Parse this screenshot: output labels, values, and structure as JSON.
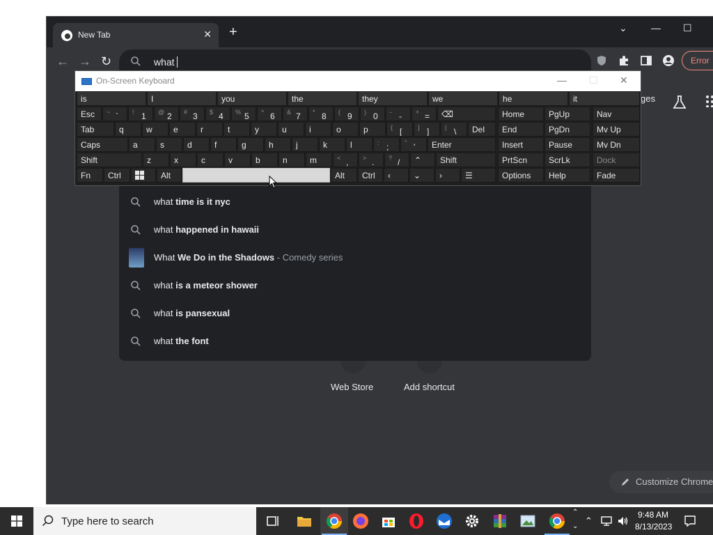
{
  "browser": {
    "tab_title": "New Tab",
    "omnibox_text": "what",
    "error_label": "Error",
    "partial_header_text": "ges"
  },
  "suggestions": [
    {
      "prefix": "what",
      "bold": "time is it nyc",
      "sub": ""
    },
    {
      "prefix": "what",
      "bold": "happened in hawaii",
      "sub": ""
    },
    {
      "prefix": "What",
      "bold": "We Do in the Shadows",
      "sub": " - Comedy series"
    },
    {
      "prefix": "what",
      "bold": "is a meteor shower",
      "sub": ""
    },
    {
      "prefix": "what",
      "bold": "is pansexual",
      "sub": ""
    },
    {
      "prefix": "what",
      "bold": "the font",
      "sub": ""
    }
  ],
  "ntp": {
    "shortcut_webstore": "Web Store",
    "shortcut_add": "Add shortcut",
    "customize": "Customize Chrome"
  },
  "osk": {
    "title": "On-Screen Keyboard",
    "predictions": [
      "is",
      "I",
      "you",
      "the",
      "they",
      "we",
      "he",
      "it"
    ],
    "row1": [
      "Esc"
    ],
    "row1_keys": [
      {
        "s": "~",
        "m": "`"
      },
      {
        "s": "!",
        "m": "1"
      },
      {
        "s": "@",
        "m": "2"
      },
      {
        "s": "#",
        "m": "3"
      },
      {
        "s": "$",
        "m": "4"
      },
      {
        "s": "%",
        "m": "5"
      },
      {
        "s": "^",
        "m": "6"
      },
      {
        "s": "&",
        "m": "7"
      },
      {
        "s": "*",
        "m": "8"
      },
      {
        "s": "(",
        "m": "9"
      },
      {
        "s": ")",
        "m": "0"
      },
      {
        "s": "-",
        "m": "-"
      },
      {
        "s": "+",
        "m": "="
      }
    ],
    "row2": [
      "Tab",
      "q",
      "w",
      "e",
      "r",
      "t",
      "y",
      "u",
      "i",
      "o",
      "p"
    ],
    "row2_sym": [
      {
        "s": "{",
        "m": "["
      },
      {
        "s": "}",
        "m": "]"
      },
      {
        "s": "|",
        "m": "\\"
      }
    ],
    "del": "Del",
    "row3": [
      "Caps",
      "a",
      "s",
      "d",
      "f",
      "g",
      "h",
      "j",
      "k",
      "l"
    ],
    "row3_sym": [
      {
        "s": ":",
        "m": ";"
      },
      {
        "s": "\"",
        "m": "'"
      }
    ],
    "enter": "Enter",
    "row4": [
      "Shift",
      "z",
      "x",
      "c",
      "v",
      "b",
      "n",
      "m"
    ],
    "row4_sym": [
      {
        "s": "<",
        "m": ","
      },
      {
        "s": ">",
        "m": "."
      },
      {
        "s": "?",
        "m": "/"
      }
    ],
    "shift_r": "Shift",
    "row5": [
      "Fn",
      "Ctrl",
      "Alt",
      "Alt",
      "Ctrl"
    ],
    "nav_keys": [
      [
        "Home",
        "PgUp",
        "Nav"
      ],
      [
        "End",
        "PgDn",
        "Mv Up"
      ],
      [
        "Insert",
        "Pause",
        "Mv Dn"
      ],
      [
        "PrtScn",
        "ScrLk",
        "Dock"
      ],
      [
        "Options",
        "Help",
        "Fade"
      ]
    ]
  },
  "taskbar": {
    "search_placeholder": "Type here to search",
    "time": "9:48 AM",
    "date": "8/13/2023"
  }
}
